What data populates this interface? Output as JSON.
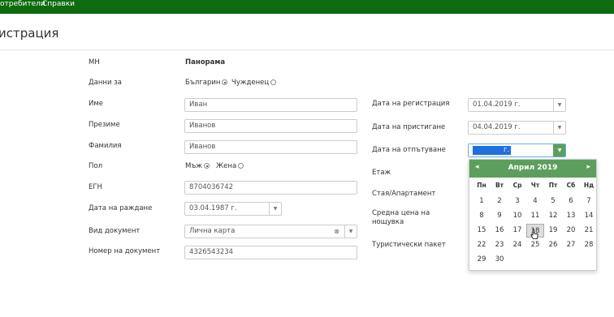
{
  "topnav": {
    "users": "отребители",
    "reports": "Справки"
  },
  "page_title": "истрация",
  "form": {
    "mn_label": "МН",
    "mn_value": "Панорама",
    "data_for_label": "Данни за",
    "bulgarian": "Българин",
    "foreigner": "Чужденец",
    "first_name_label": "Име",
    "first_name": "Иван",
    "middle_name_label": "Презиме",
    "middle_name": "Иванов",
    "last_name_label": "Фамилия",
    "last_name": "Иванов",
    "sex_label": "Пол",
    "male": "Мъж",
    "female": "Жена",
    "egn_label": "ЕГН",
    "egn": "8704036742",
    "birth_date_label": "Дата на раждане",
    "birth_date": "03.04.1987 г.",
    "doc_type_label": "Вид документ",
    "doc_type": "Лична карта",
    "doc_no_label": "Номер на документ",
    "doc_no": "4326543234",
    "reg_date_label": "Дата на регистрация",
    "reg_date": "01.04.2019 г.",
    "arrival_label": "Дата на пристигане",
    "arrival": "04.04.2019 г.",
    "departure_label": "Дата на отпътуване",
    "departure": "г.",
    "floor_label": "Етаж",
    "room_label": "Стая/Апартамент",
    "avg_price_label_1": "Средна цена на",
    "avg_price_label_2": "нощувка",
    "package_label": "Туристически пакет"
  },
  "calendar": {
    "month": "Април 2019",
    "prev": "◂",
    "next": "▸",
    "weekdays": [
      "Пн",
      "Вт",
      "Ср",
      "Чт",
      "Пт",
      "Сб",
      "Нд"
    ],
    "weeks": [
      [
        "",
        "1",
        "2",
        "3",
        "4",
        "5",
        "6",
        "7"
      ],
      [
        "8",
        "9",
        "10",
        "11",
        "12",
        "13",
        "14"
      ],
      [
        "15",
        "16",
        "17",
        "18",
        "19",
        "20",
        "21"
      ],
      [
        "22",
        "23",
        "24",
        "25",
        "26",
        "27",
        "28"
      ],
      [
        "29",
        "30"
      ]
    ],
    "selected": "18"
  },
  "colors": {
    "topbar": "#0f6b0f",
    "calendar_header": "#5c9f5c",
    "selection": "#1e6fe0"
  }
}
